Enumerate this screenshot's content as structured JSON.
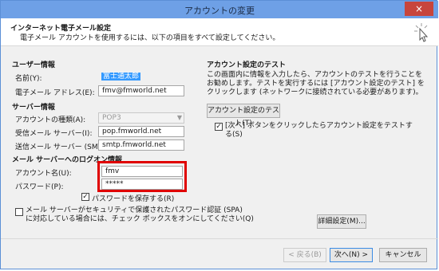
{
  "window": {
    "title": "アカウントの変更",
    "close_glyph": "×"
  },
  "header": {
    "title": "インターネット電子メール設定",
    "subtitle": "電子メール アカウントを使用するには、以下の項目をすべて設定してください。",
    "icon": "cursor-click-icon"
  },
  "user_info": {
    "heading": "ユーザー情報",
    "name_label": "名前(Y):",
    "name_value": "富士通太郎",
    "email_label": "電子メール アドレス(E):",
    "email_value": "fmv@fmworld.net"
  },
  "server_info": {
    "heading": "サーバー情報",
    "account_type_label": "アカウントの種類(A):",
    "account_type_value": "POP3",
    "incoming_label": "受信メール サーバー(I):",
    "incoming_value": "pop.fmworld.net",
    "outgoing_label": "送信メール サーバー (SMTP)(O):",
    "outgoing_value": "smtp.fmworld.net"
  },
  "logon_info": {
    "heading": "メール サーバーへのログオン情報",
    "account_name_label": "アカウント名(U):",
    "account_name_value": "fmv",
    "password_label": "パスワード(P):",
    "password_value": "*****",
    "remember_label": "パスワードを保存する(R)",
    "remember_checked": true,
    "spa_label_line1": "メール サーバーがセキュリティで保護されたパスワード認証 (SPA)",
    "spa_label_line2": "に対応している場合には、チェック ボックスをオンにしてください(Q)",
    "spa_checked": false
  },
  "test_section": {
    "heading": "アカウント設定のテスト",
    "description_line1": "この画面内に情報を入力したら、アカウントのテストを行うことを",
    "description_line2": "お勧めします。テストを実行するには [アカウント設定のテスト] を",
    "description_line3": "クリックします (ネットワークに接続されている必要があります)。",
    "test_button": "アカウント設定のテスト(T)",
    "next_test_label_line1": "[次へ] ボタンをクリックしたらアカウント設定をテストす",
    "next_test_label_line2": "る(S)",
    "next_test_checked": true,
    "more_settings_button": "詳細設定(M)..."
  },
  "footer": {
    "back_button": "< 戻る(B)",
    "next_button": "次へ(N) >",
    "cancel_button": "キャンセル"
  },
  "colors": {
    "titlebar": "#6ea0e6",
    "close": "#c7453c",
    "highlight": "#3399ff",
    "annotation_box": "#e00000"
  }
}
